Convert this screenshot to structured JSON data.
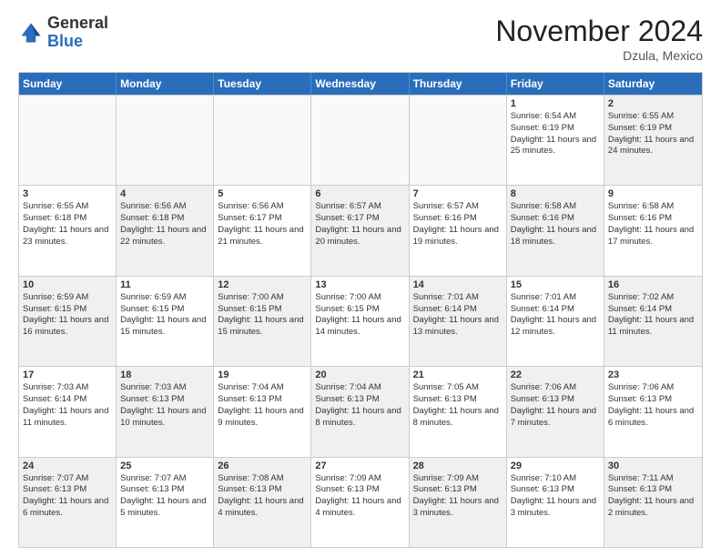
{
  "header": {
    "logo": {
      "general": "General",
      "blue": "Blue"
    },
    "title": "November 2024",
    "location": "Dzula, Mexico"
  },
  "weekdays": [
    "Sunday",
    "Monday",
    "Tuesday",
    "Wednesday",
    "Thursday",
    "Friday",
    "Saturday"
  ],
  "rows": [
    [
      {
        "day": "",
        "empty": true
      },
      {
        "day": "",
        "empty": true
      },
      {
        "day": "",
        "empty": true
      },
      {
        "day": "",
        "empty": true
      },
      {
        "day": "",
        "empty": true
      },
      {
        "day": "1",
        "sunrise": "Sunrise: 6:54 AM",
        "sunset": "Sunset: 6:19 PM",
        "daylight": "Daylight: 11 hours and 25 minutes."
      },
      {
        "day": "2",
        "sunrise": "Sunrise: 6:55 AM",
        "sunset": "Sunset: 6:19 PM",
        "daylight": "Daylight: 11 hours and 24 minutes.",
        "shaded": true
      }
    ],
    [
      {
        "day": "3",
        "sunrise": "Sunrise: 6:55 AM",
        "sunset": "Sunset: 6:18 PM",
        "daylight": "Daylight: 11 hours and 23 minutes."
      },
      {
        "day": "4",
        "sunrise": "Sunrise: 6:56 AM",
        "sunset": "Sunset: 6:18 PM",
        "daylight": "Daylight: 11 hours and 22 minutes.",
        "shaded": true
      },
      {
        "day": "5",
        "sunrise": "Sunrise: 6:56 AM",
        "sunset": "Sunset: 6:17 PM",
        "daylight": "Daylight: 11 hours and 21 minutes."
      },
      {
        "day": "6",
        "sunrise": "Sunrise: 6:57 AM",
        "sunset": "Sunset: 6:17 PM",
        "daylight": "Daylight: 11 hours and 20 minutes.",
        "shaded": true
      },
      {
        "day": "7",
        "sunrise": "Sunrise: 6:57 AM",
        "sunset": "Sunset: 6:16 PM",
        "daylight": "Daylight: 11 hours and 19 minutes."
      },
      {
        "day": "8",
        "sunrise": "Sunrise: 6:58 AM",
        "sunset": "Sunset: 6:16 PM",
        "daylight": "Daylight: 11 hours and 18 minutes.",
        "shaded": true
      },
      {
        "day": "9",
        "sunrise": "Sunrise: 6:58 AM",
        "sunset": "Sunset: 6:16 PM",
        "daylight": "Daylight: 11 hours and 17 minutes."
      }
    ],
    [
      {
        "day": "10",
        "sunrise": "Sunrise: 6:59 AM",
        "sunset": "Sunset: 6:15 PM",
        "daylight": "Daylight: 11 hours and 16 minutes.",
        "shaded": true
      },
      {
        "day": "11",
        "sunrise": "Sunrise: 6:59 AM",
        "sunset": "Sunset: 6:15 PM",
        "daylight": "Daylight: 11 hours and 15 minutes."
      },
      {
        "day": "12",
        "sunrise": "Sunrise: 7:00 AM",
        "sunset": "Sunset: 6:15 PM",
        "daylight": "Daylight: 11 hours and 15 minutes.",
        "shaded": true
      },
      {
        "day": "13",
        "sunrise": "Sunrise: 7:00 AM",
        "sunset": "Sunset: 6:15 PM",
        "daylight": "Daylight: 11 hours and 14 minutes."
      },
      {
        "day": "14",
        "sunrise": "Sunrise: 7:01 AM",
        "sunset": "Sunset: 6:14 PM",
        "daylight": "Daylight: 11 hours and 13 minutes.",
        "shaded": true
      },
      {
        "day": "15",
        "sunrise": "Sunrise: 7:01 AM",
        "sunset": "Sunset: 6:14 PM",
        "daylight": "Daylight: 11 hours and 12 minutes."
      },
      {
        "day": "16",
        "sunrise": "Sunrise: 7:02 AM",
        "sunset": "Sunset: 6:14 PM",
        "daylight": "Daylight: 11 hours and 11 minutes.",
        "shaded": true
      }
    ],
    [
      {
        "day": "17",
        "sunrise": "Sunrise: 7:03 AM",
        "sunset": "Sunset: 6:14 PM",
        "daylight": "Daylight: 11 hours and 11 minutes."
      },
      {
        "day": "18",
        "sunrise": "Sunrise: 7:03 AM",
        "sunset": "Sunset: 6:13 PM",
        "daylight": "Daylight: 11 hours and 10 minutes.",
        "shaded": true
      },
      {
        "day": "19",
        "sunrise": "Sunrise: 7:04 AM",
        "sunset": "Sunset: 6:13 PM",
        "daylight": "Daylight: 11 hours and 9 minutes."
      },
      {
        "day": "20",
        "sunrise": "Sunrise: 7:04 AM",
        "sunset": "Sunset: 6:13 PM",
        "daylight": "Daylight: 11 hours and 8 minutes.",
        "shaded": true
      },
      {
        "day": "21",
        "sunrise": "Sunrise: 7:05 AM",
        "sunset": "Sunset: 6:13 PM",
        "daylight": "Daylight: 11 hours and 8 minutes."
      },
      {
        "day": "22",
        "sunrise": "Sunrise: 7:06 AM",
        "sunset": "Sunset: 6:13 PM",
        "daylight": "Daylight: 11 hours and 7 minutes.",
        "shaded": true
      },
      {
        "day": "23",
        "sunrise": "Sunrise: 7:06 AM",
        "sunset": "Sunset: 6:13 PM",
        "daylight": "Daylight: 11 hours and 6 minutes."
      }
    ],
    [
      {
        "day": "24",
        "sunrise": "Sunrise: 7:07 AM",
        "sunset": "Sunset: 6:13 PM",
        "daylight": "Daylight: 11 hours and 6 minutes.",
        "shaded": true
      },
      {
        "day": "25",
        "sunrise": "Sunrise: 7:07 AM",
        "sunset": "Sunset: 6:13 PM",
        "daylight": "Daylight: 11 hours and 5 minutes."
      },
      {
        "day": "26",
        "sunrise": "Sunrise: 7:08 AM",
        "sunset": "Sunset: 6:13 PM",
        "daylight": "Daylight: 11 hours and 4 minutes.",
        "shaded": true
      },
      {
        "day": "27",
        "sunrise": "Sunrise: 7:09 AM",
        "sunset": "Sunset: 6:13 PM",
        "daylight": "Daylight: 11 hours and 4 minutes."
      },
      {
        "day": "28",
        "sunrise": "Sunrise: 7:09 AM",
        "sunset": "Sunset: 6:13 PM",
        "daylight": "Daylight: 11 hours and 3 minutes.",
        "shaded": true
      },
      {
        "day": "29",
        "sunrise": "Sunrise: 7:10 AM",
        "sunset": "Sunset: 6:13 PM",
        "daylight": "Daylight: 11 hours and 3 minutes."
      },
      {
        "day": "30",
        "sunrise": "Sunrise: 7:11 AM",
        "sunset": "Sunset: 6:13 PM",
        "daylight": "Daylight: 11 hours and 2 minutes.",
        "shaded": true
      }
    ]
  ]
}
